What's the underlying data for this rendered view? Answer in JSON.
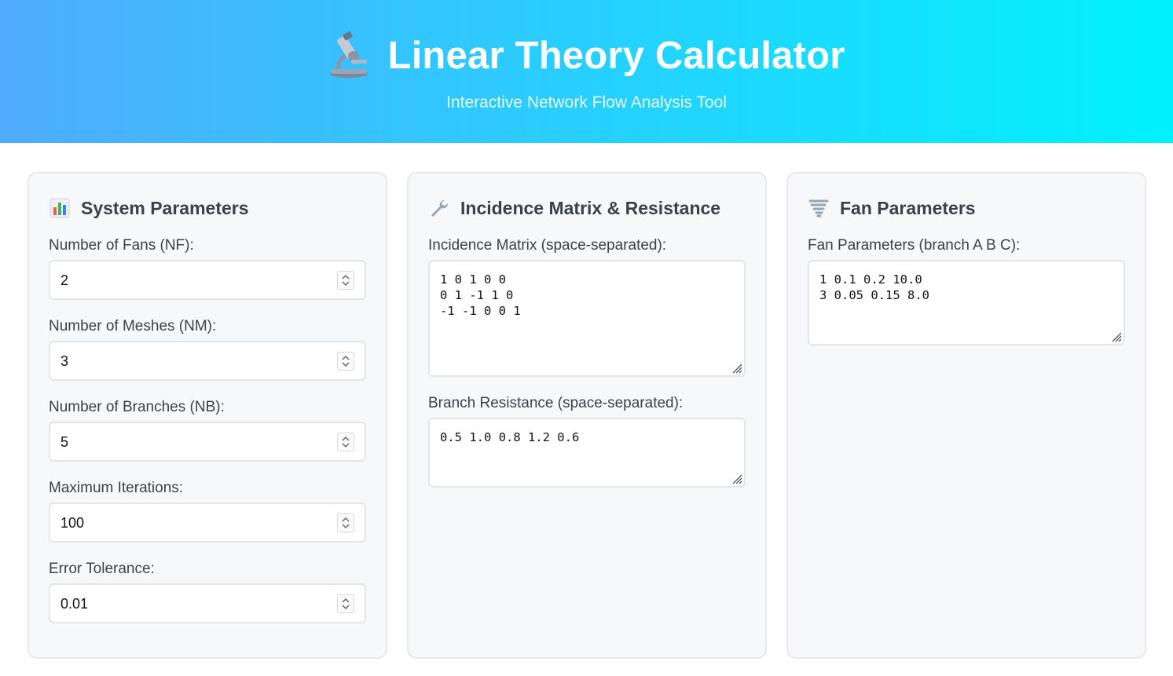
{
  "header": {
    "title": "Linear Theory Calculator",
    "subtitle": "Interactive Network Flow Analysis Tool",
    "icon": "microscope-icon"
  },
  "system": {
    "title": "System Parameters",
    "icon": "bar-chart-icon",
    "fields": [
      {
        "label": "Number of Fans (NF):",
        "value": "2"
      },
      {
        "label": "Number of Meshes (NM):",
        "value": "3"
      },
      {
        "label": "Number of Branches (NB):",
        "value": "5"
      },
      {
        "label": "Maximum Iterations:",
        "value": "100"
      },
      {
        "label": "Error Tolerance:",
        "value": "0.01"
      }
    ]
  },
  "matrix": {
    "title": "Incidence Matrix & Resistance",
    "icon": "wrench-icon",
    "incidence_label": "Incidence Matrix (space-separated):",
    "incidence_value": "1 0 1 0 0\n0 1 -1 1 0\n-1 -1 0 0 1",
    "resistance_label": "Branch Resistance (space-separated):",
    "resistance_value": "0.5 1.0 0.8 1.2 0.6"
  },
  "fan": {
    "title": "Fan Parameters",
    "icon": "tornado-icon",
    "params_label": "Fan Parameters (branch A B C):",
    "params_value": "1 0.1 0.2 10.0\n3 0.05 0.15 8.0"
  }
}
